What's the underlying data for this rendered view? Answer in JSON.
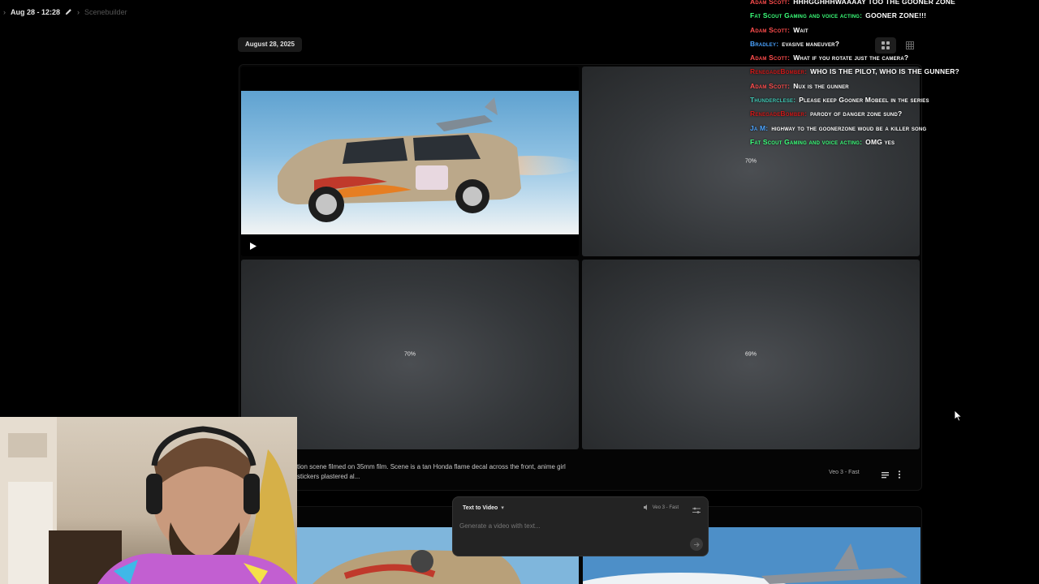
{
  "topbar": {
    "title": "Aug 28 - 12:28",
    "crumb": "Scenebuilder"
  },
  "date_chip": "August 28, 2025",
  "tiles": [
    {
      "kind": "video"
    },
    {
      "kind": "generating",
      "progress": "70%"
    },
    {
      "kind": "generating",
      "progress": "70%"
    },
    {
      "kind": "generating",
      "progress": "69%"
    }
  ],
  "prompt": {
    "text": "tion scene filmed on 35mm film. Scene is a tan Honda flame decal across the front, anime girl stickers plastered al...",
    "model": "Veo 3 - Fast"
  },
  "composer": {
    "mode": "Text to Video",
    "model": "Veo 3 - Fast",
    "placeholder": "Generate a video with text..."
  },
  "chat": [
    {
      "user": "Adam Scott:",
      "text": "HHHGGHHHWAAAAY TOO THE GOONER ZONE",
      "color": "#ff4d4d"
    },
    {
      "user": "Fat Scout Gaming and voice acting:",
      "text": "GOONER ZONE!!!",
      "color": "#3bff7a"
    },
    {
      "user": "Adam Scott:",
      "text": "Wait",
      "color": "#ff4d4d"
    },
    {
      "user": "Bradley:",
      "text": "evasive maneuver?",
      "color": "#4aa3ff"
    },
    {
      "user": "Adam Scott:",
      "text": "What if you rotate just the camera?",
      "color": "#ff4d4d"
    },
    {
      "user": "RenegadeBomber:",
      "text": "WHO IS THE PILOT, WHO IS THE GUNNER?",
      "color": "#d01818"
    },
    {
      "user": "Adam Scott:",
      "text": "Nux is the gunner",
      "color": "#ff4d4d"
    },
    {
      "user": "Thunderclese:",
      "text": "Please keep Gooner Mobeel in the series",
      "color": "#3fc7b4"
    },
    {
      "user": "RenegadeBomber:",
      "text": "parody of danger zone sund?",
      "color": "#d01818"
    },
    {
      "user": "Ja M:",
      "text": "highway to the goonerzone woud be a killer song",
      "color": "#4aa3ff"
    },
    {
      "user": "Fat Scout Gaming and voice acting:",
      "text": "OMG yes",
      "color": "#3bff7a"
    }
  ]
}
